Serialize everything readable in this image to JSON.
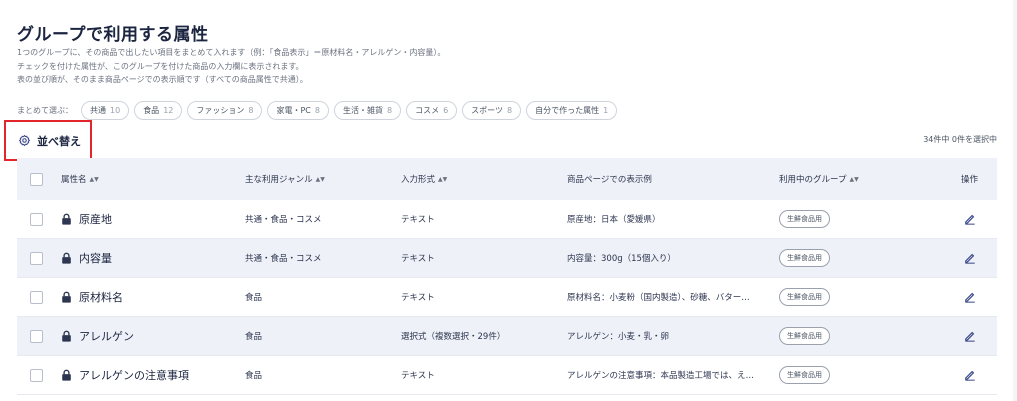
{
  "page": {
    "title": "グループで利用する属性",
    "description": [
      "1つのグループに、その商品で出したい項目をまとめて入れます（例：「食品表示」＝原材料名・アレルゲン・内容量）。",
      "チェックを付けた属性が、このグループを付けた商品の入力欄に表示されます。",
      "表の並び順が、そのまま商品ページでの表示順です（すべての商品属性で共通）。"
    ]
  },
  "chips": {
    "label": "まとめて選ぶ：",
    "items": [
      {
        "name": "共通",
        "count": "10"
      },
      {
        "name": "食品",
        "count": "12"
      },
      {
        "name": "ファッション",
        "count": "8"
      },
      {
        "name": "家電・PC",
        "count": "8"
      },
      {
        "name": "生活・雑貨",
        "count": "8"
      },
      {
        "name": "コスメ",
        "count": "6"
      },
      {
        "name": "スポーツ",
        "count": "8"
      },
      {
        "name": "自分で作った属性",
        "count": "1"
      }
    ]
  },
  "toolbar": {
    "sort_label": "並べ替え",
    "count_info": "34件中 0件を選択中"
  },
  "table": {
    "headers": {
      "name": "属性名",
      "genre": "主な利用ジャンル",
      "input": "入力形式",
      "example": "商品ページでの表示例",
      "group": "利用中のグループ",
      "action": "操作"
    },
    "rows": [
      {
        "name": "原産地",
        "genre": "共通・食品・コスメ",
        "input": "テキスト",
        "example": "原産地：日本（愛媛県）",
        "group": "生鮮食品用"
      },
      {
        "name": "内容量",
        "genre": "共通・食品・コスメ",
        "input": "テキスト",
        "example": "内容量：300g（15個入り）",
        "group": "生鮮食品用"
      },
      {
        "name": "原材料名",
        "genre": "食品",
        "input": "テキスト",
        "example": "原材料名：小麦粉（国内製造）、砂糖、バター…",
        "group": "生鮮食品用"
      },
      {
        "name": "アレルゲン",
        "genre": "食品",
        "input": "選択式（複数選択・29件）",
        "example": "アレルゲン：小麦・乳・卵",
        "group": "生鮮食品用"
      },
      {
        "name": "アレルゲンの注意事項",
        "genre": "食品",
        "input": "テキスト",
        "example": "アレルゲンの注意事項：本品製造工場では、え…",
        "group": "生鮮食品用"
      }
    ]
  },
  "colors": {
    "accent_red": "#e3262c",
    "header_bg": "#eef1f7",
    "title": "#1b2540",
    "icon_blue": "#3b4a8c"
  }
}
